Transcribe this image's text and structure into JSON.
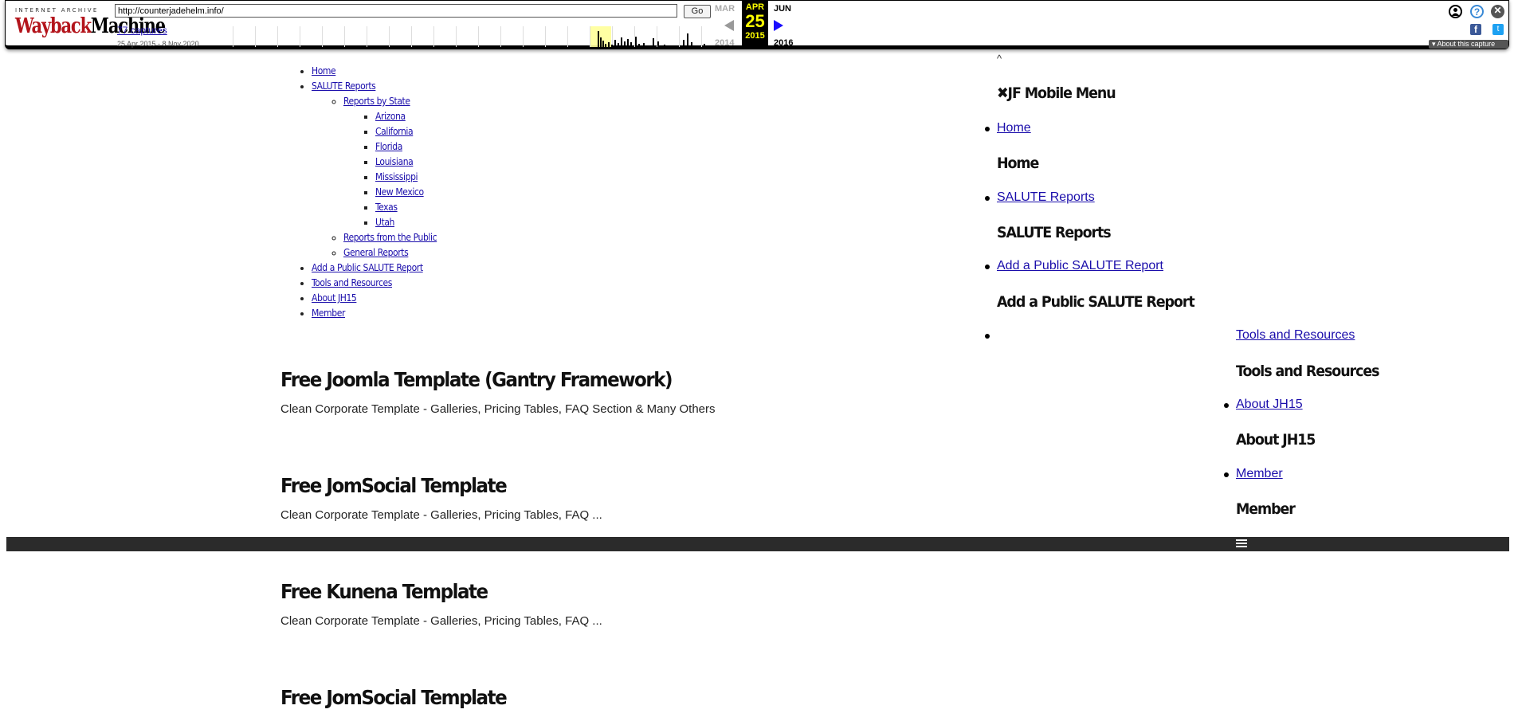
{
  "wayback": {
    "logo_top": "INTERNET ARCHIVE",
    "logo_main_a": "Wayback",
    "logo_main_b": "Machine",
    "url": "http://counterjadehelm.info/",
    "go_label": "Go",
    "captures": "77 captures",
    "range": "25 Apr 2015 - 8 Nov 2020",
    "prev_month": "MAR",
    "cur_month": "APR",
    "next_month": "JUN",
    "cur_day": "25",
    "prev_year": "2014",
    "cur_year": "2015",
    "next_year": "2016",
    "about": "About this capture",
    "icons": [
      "user-icon",
      "help-icon",
      "close-icon",
      "facebook-icon",
      "twitter-icon"
    ]
  },
  "nav": {
    "home": "Home",
    "salute": "SALUTE Reports",
    "by_state": "Reports by State",
    "states": [
      "Arizona",
      "California",
      "Florida",
      "Louisiana",
      "Mississippi",
      "New Mexico",
      "Texas",
      "Utah"
    ],
    "from_public": "Reports from the Public",
    "general": "General Reports",
    "add_public": "Add a Public SALUTE Report",
    "tools": "Tools and Resources",
    "about": "About JH15",
    "member": "Member"
  },
  "articles": [
    {
      "title": "Free Joomla Template (Gantry Framework)",
      "desc": "Clean Corporate Template - Galleries, Pricing Tables, FAQ Section & Many Others"
    },
    {
      "title": "Free JomSocial Template",
      "desc": "Clean Corporate Template - Galleries, Pricing Tables, FAQ ..."
    },
    {
      "title": "Free Kunena Template",
      "desc": "Clean Corporate Template - Galleries, Pricing Tables, FAQ ..."
    },
    {
      "title": "Free JomSocial Template",
      "desc": ""
    }
  ],
  "mobile_menu": {
    "caret": "^",
    "title": "✖JF Mobile Menu",
    "items": [
      {
        "link": "Home",
        "heading": "Home"
      },
      {
        "link": "SALUTE Reports",
        "heading": "SALUTE Reports"
      },
      {
        "link": "Add a Public SALUTE Report",
        "heading": "Add a Public SALUTE Report"
      },
      {
        "link": "Tools and Resources",
        "heading": "Tools and Resources"
      },
      {
        "link": "About JH15",
        "heading": "About JH15"
      },
      {
        "link": "Member",
        "heading": "Member"
      }
    ]
  }
}
